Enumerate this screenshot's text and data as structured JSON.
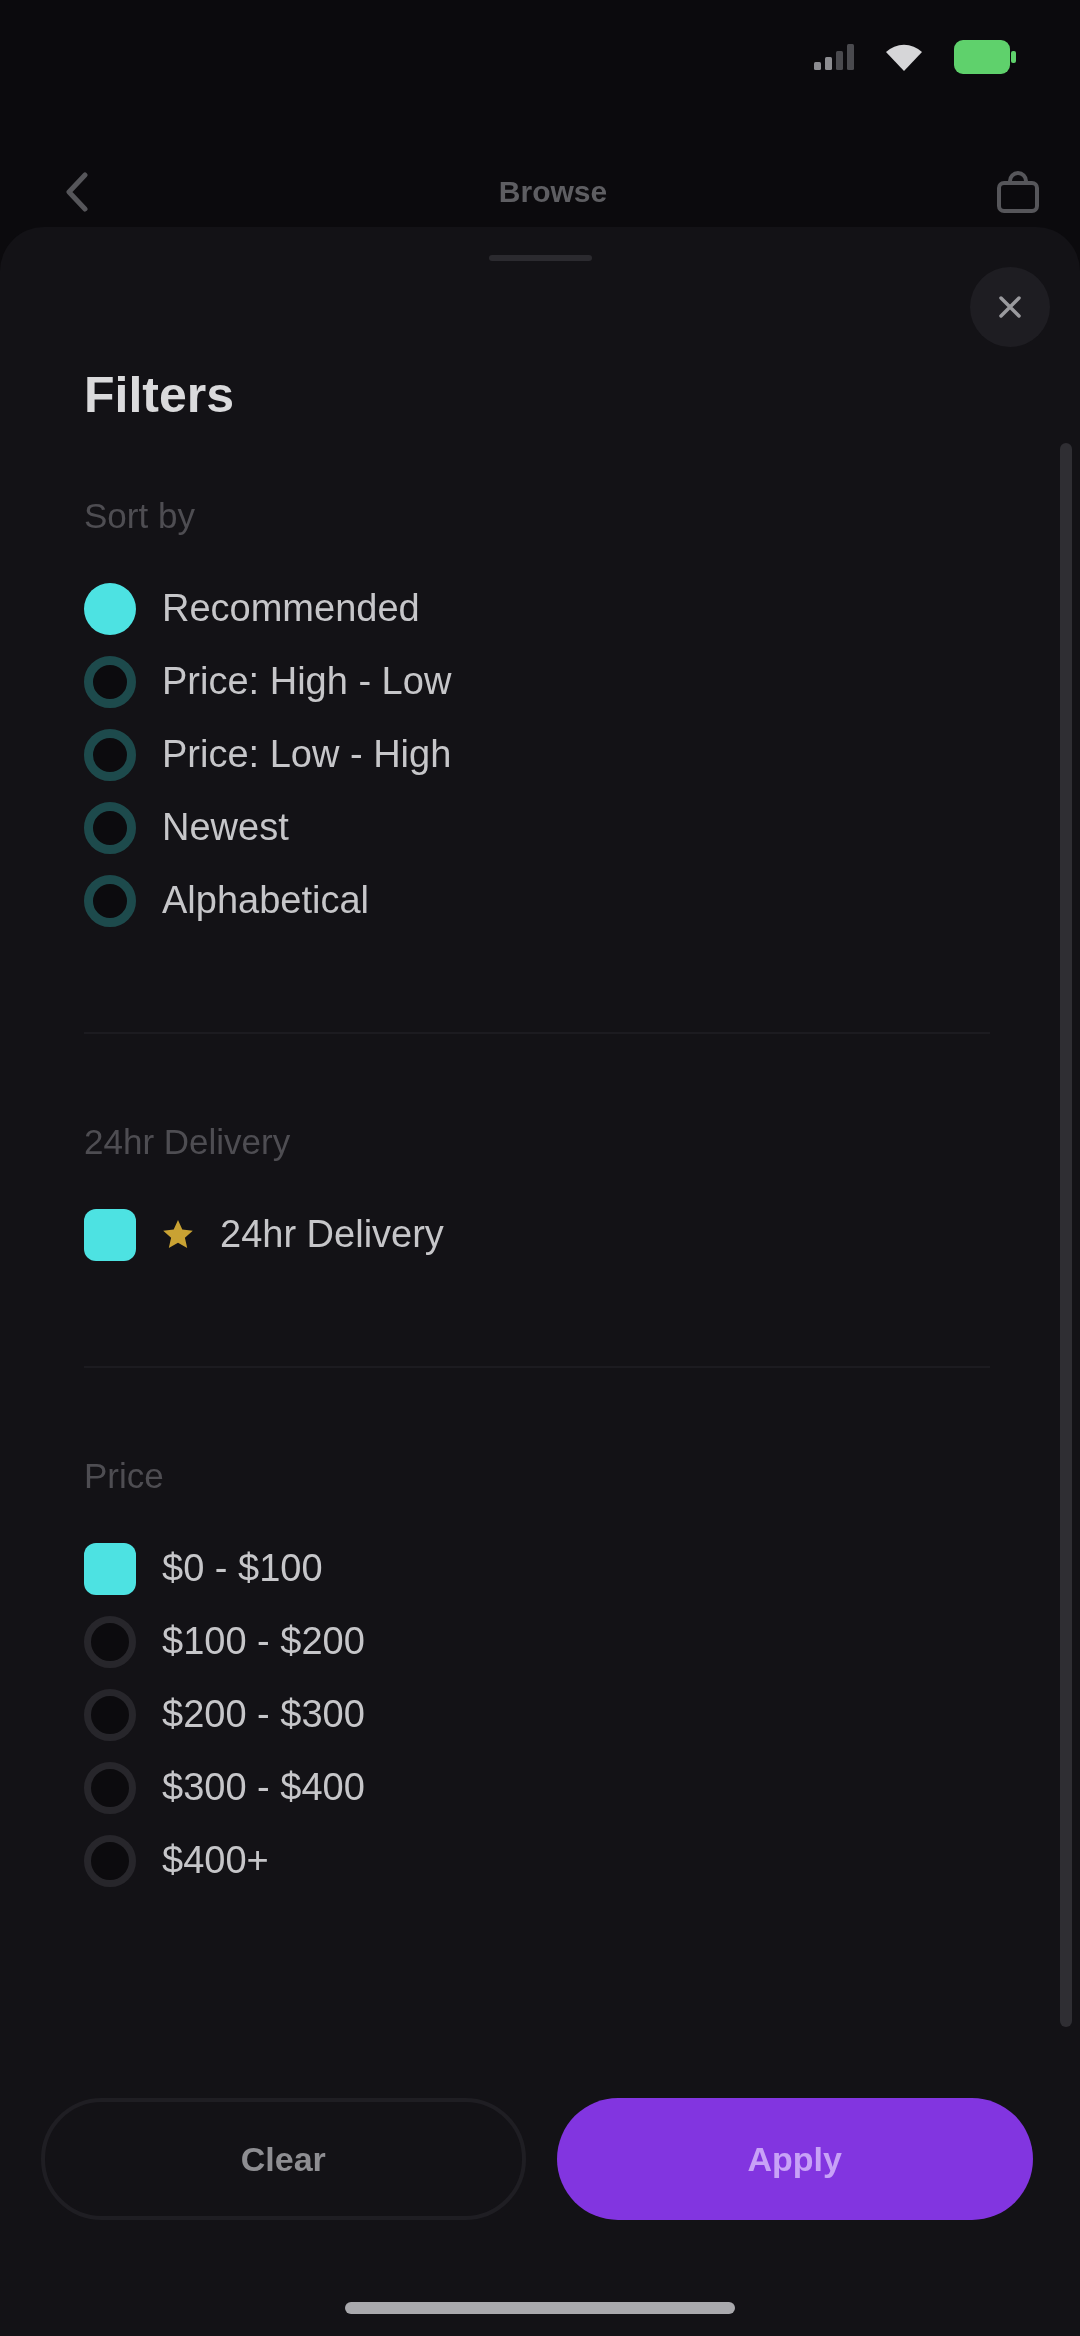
{
  "nav": {
    "title": "Browse"
  },
  "sheet": {
    "title": "Filters",
    "sections": [
      {
        "kind": "sort",
        "label": "Sort by",
        "options": [
          {
            "label": "Recommended",
            "selected": true
          },
          {
            "label": "Price: High - Low",
            "selected": false
          },
          {
            "label": "Price: Low - High",
            "selected": false
          },
          {
            "label": "Newest",
            "selected": false
          },
          {
            "label": "Alphabetical",
            "selected": false
          }
        ]
      },
      {
        "kind": "delivery",
        "label": "24hr Delivery",
        "options": [
          {
            "label": "24hr Delivery",
            "checked": true
          }
        ]
      },
      {
        "kind": "price",
        "label": "Price",
        "options": [
          {
            "label": "$0 - $100",
            "checked": true
          },
          {
            "label": "$100 - $200",
            "checked": false
          },
          {
            "label": "$200 - $300",
            "checked": false
          },
          {
            "label": "$300 - $400",
            "checked": false
          },
          {
            "label": "$400+",
            "checked": false
          }
        ]
      }
    ]
  },
  "actions": [
    {
      "label": "Clear",
      "kind": "secondary"
    },
    {
      "label": "Apply",
      "kind": "primary"
    }
  ]
}
